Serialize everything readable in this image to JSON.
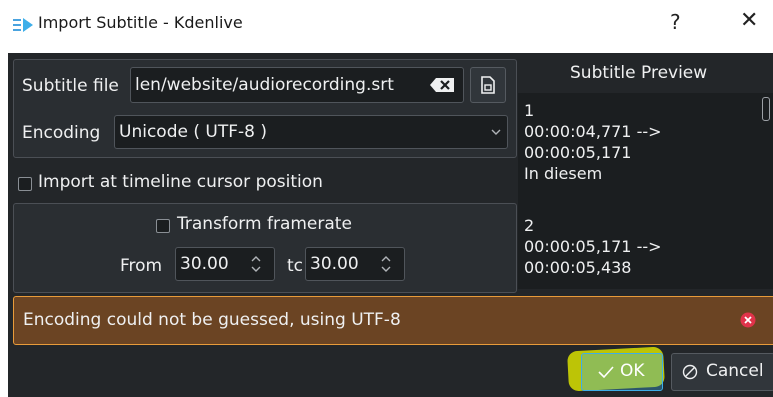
{
  "window": {
    "title": "Import Subtitle - Kdenlive",
    "help": "?",
    "close": "✕"
  },
  "form": {
    "subtitle_file_label": "Subtitle file",
    "subtitle_file_value": "len/website/audiorecording.srt",
    "encoding_label": "Encoding",
    "encoding_value": "Unicode ( UTF-8 )",
    "import_at_cursor_label": "Import at timeline cursor position",
    "transform_framerate_label": "Transform framerate",
    "from_label": "From",
    "from_value": "30.00",
    "to_label": "tc",
    "to_value": "30.00"
  },
  "preview": {
    "title": "Subtitle Preview",
    "lines": [
      "1",
      "00:00:04,771 -->",
      "00:00:05,171",
      "In diesem",
      "",
      "2",
      "00:00:05,171 -->",
      "00:00:05,438"
    ]
  },
  "message": {
    "text": "Encoding could not be guessed, using UTF-8"
  },
  "buttons": {
    "ok": "OK",
    "cancel": "Cancel"
  },
  "colors": {
    "accent": "#3daee9",
    "warning_bg": "#6b4423",
    "warning_border": "#e89b3a",
    "dialog_bg": "#232629",
    "highlight": "#d8e000"
  }
}
